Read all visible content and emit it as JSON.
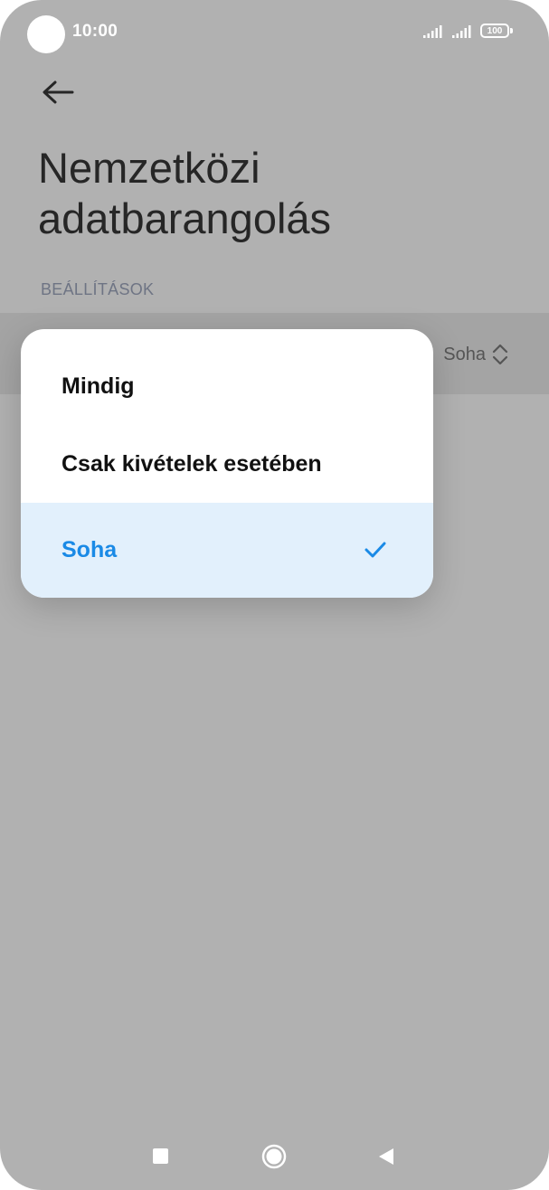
{
  "status_bar": {
    "time": "10:00",
    "battery": "100"
  },
  "header": {
    "title": "Nemzetközi adatbarangolás",
    "section_label": "BEÁLLÍTÁSOK"
  },
  "setting_row": {
    "current_value": "Soha"
  },
  "dropdown": {
    "options": [
      {
        "label": "Mindig",
        "selected": false
      },
      {
        "label": "Csak kivételek esetében",
        "selected": false
      },
      {
        "label": "Soha",
        "selected": true
      }
    ]
  },
  "colors": {
    "overlay_background": "#b1b1b1",
    "selected_text": "#1a8ae6",
    "selected_background": "#e2f0fc"
  },
  "icons": {
    "back": "arrow-left-icon",
    "check": "check-icon",
    "chevrons": "chevron-up-down-icon",
    "nav_recents": "square-icon",
    "nav_home": "circle-icon",
    "nav_back": "triangle-back-icon"
  }
}
